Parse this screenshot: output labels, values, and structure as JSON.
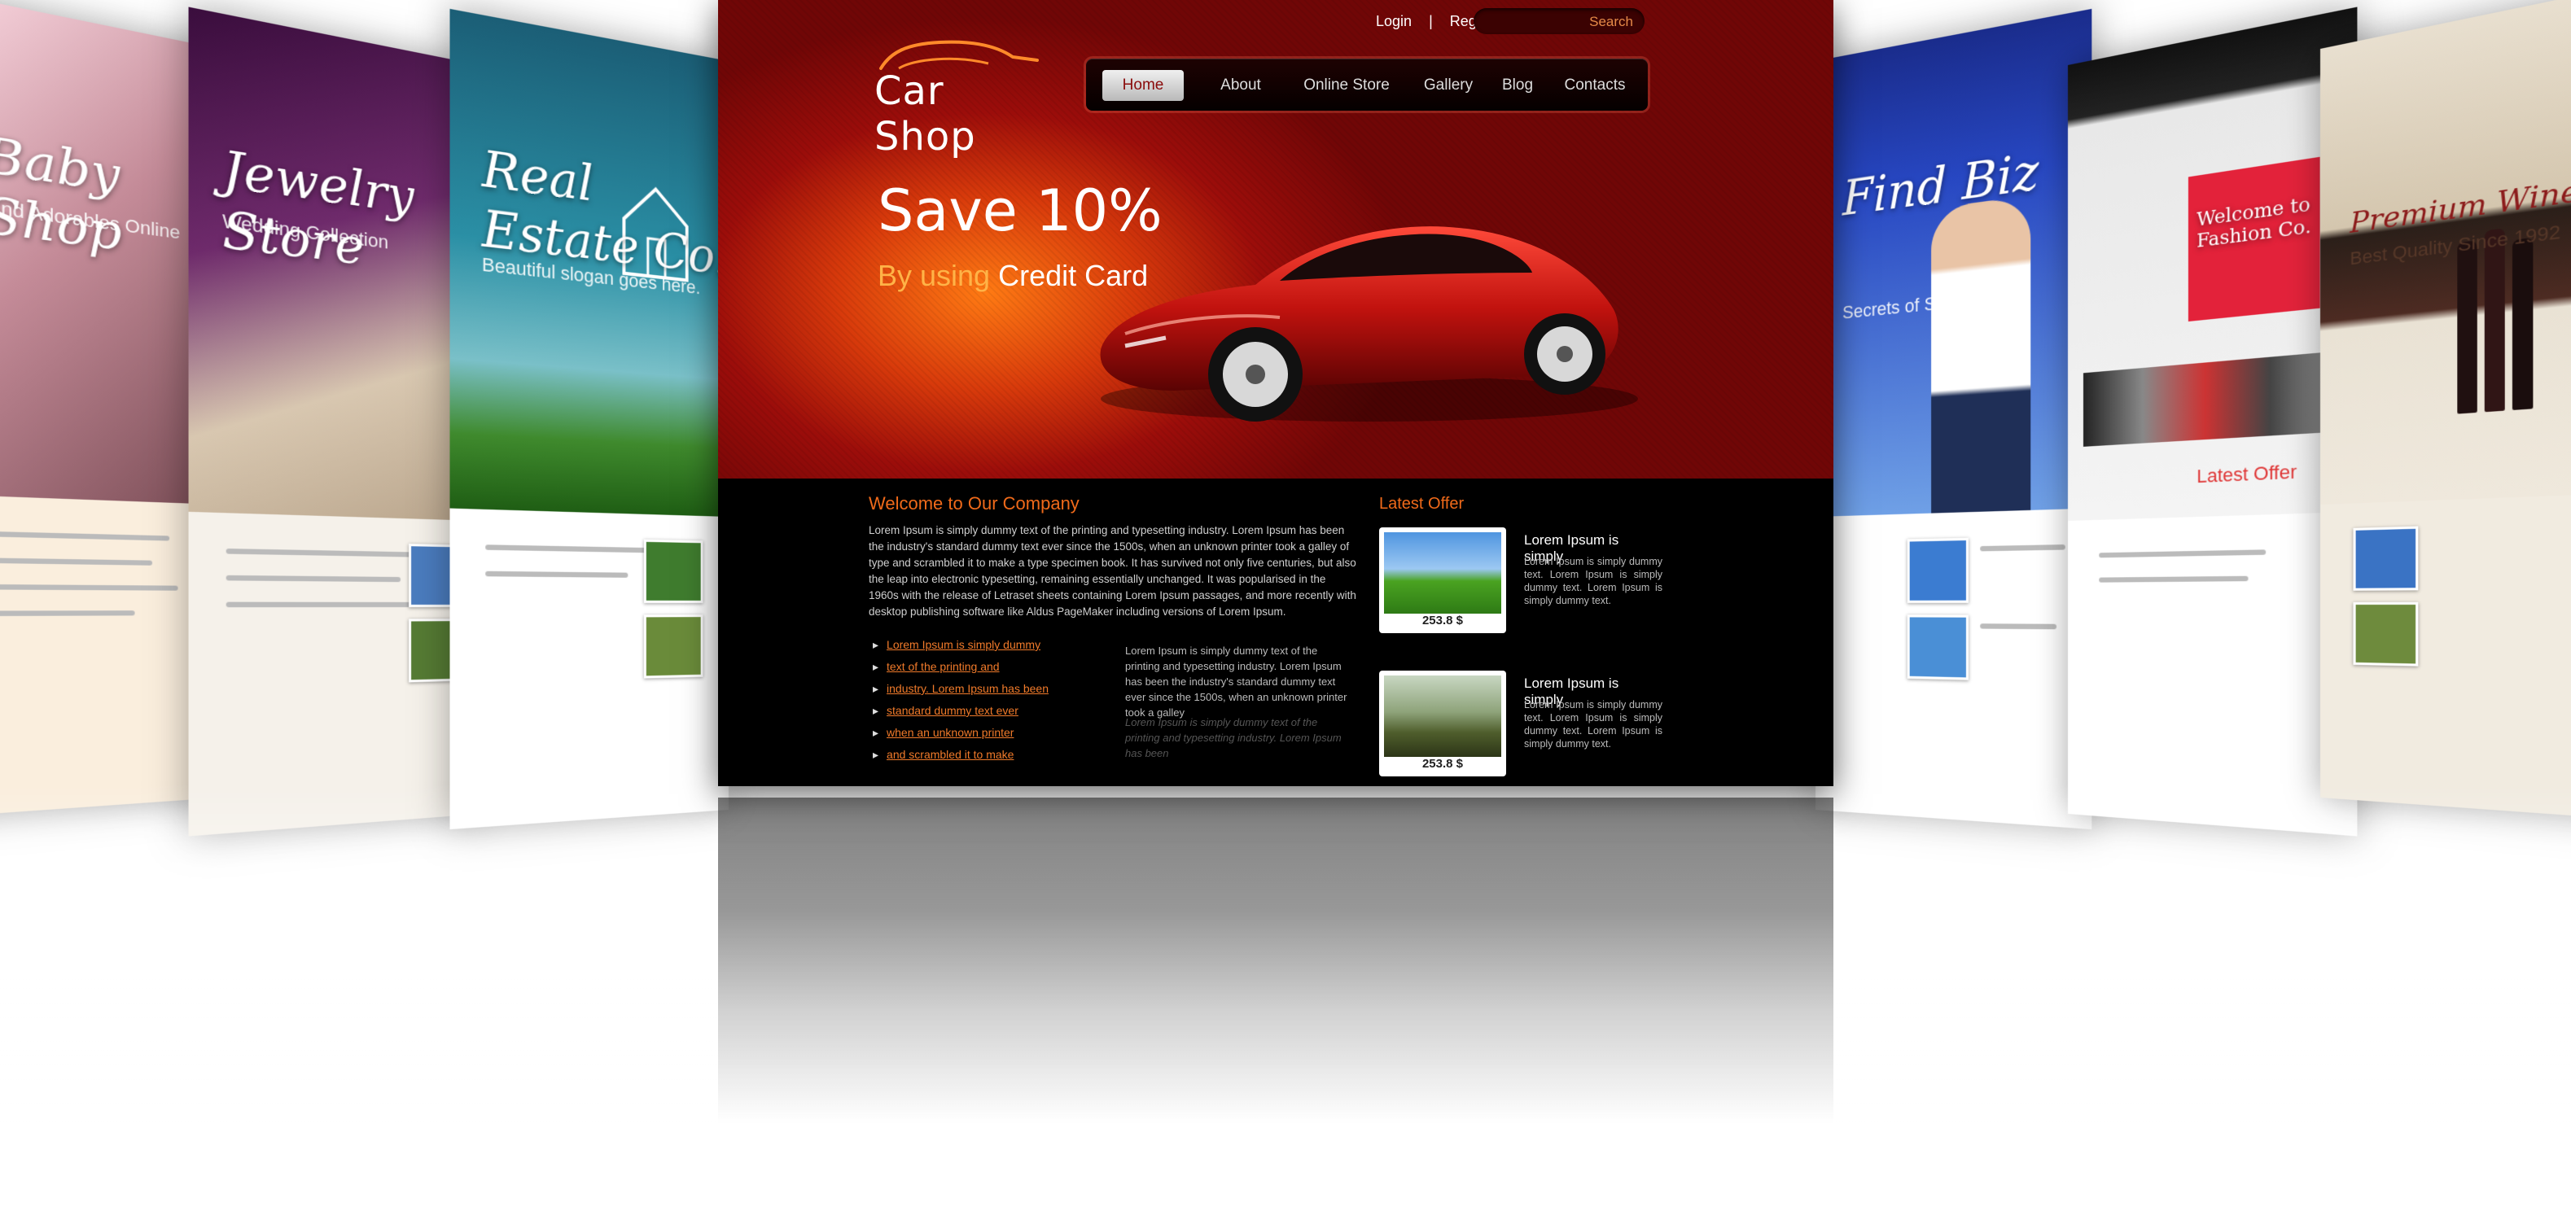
{
  "site": {
    "logo_text": "Car Shop",
    "top_links": {
      "login": "Login",
      "separator": "|",
      "register": "Register"
    },
    "search": {
      "button_label": "Search"
    },
    "nav": [
      {
        "label": "Home",
        "active": true
      },
      {
        "label": "About",
        "active": false
      },
      {
        "label": "Online Store",
        "active": false
      },
      {
        "label": "Gallery",
        "active": false
      },
      {
        "label": "Blog",
        "active": false
      },
      {
        "label": "Contacts",
        "active": false
      }
    ],
    "promo": {
      "title": "Save 10%",
      "subtitle_prefix": "By using",
      "subtitle_highlight": "Credit Card"
    },
    "welcome": {
      "title": "Welcome to Our Company",
      "text": "Lorem Ipsum is simply dummy text of the printing and typesetting industry. Lorem Ipsum has been the industry's standard dummy text ever since the 1500s, when an unknown printer took a galley of type and scrambled it to make a type specimen book. It has survived not only five centuries, but also the leap into electronic typesetting, remaining essentially unchanged. It was popularised in the 1960s with the release of Letraset sheets containing Lorem Ipsum passages, and more recently with desktop publishing software like Aldus PageMaker including versions of Lorem Ipsum.",
      "bullets": [
        "Lorem Ipsum is simply dummy",
        "text of the printing and",
        "industry. Lorem Ipsum has been",
        "standard dummy text ever",
        "when an unknown printer",
        "and scrambled it to make"
      ],
      "mid_text": "Lorem Ipsum is simply dummy text of the printing and typesetting industry. Lorem Ipsum has been the industry's standard dummy text ever since the 1500s, when an unknown printer took a galley",
      "mid_text_faded": "Lorem Ipsum is simply dummy text of the printing and typesetting industry. Lorem Ipsum has been"
    },
    "latest_offer": {
      "title": "Latest Offer",
      "items": [
        {
          "price": "253.8 $",
          "title": "Lorem Ipsum is simply",
          "text": "Lorem Ipsum is simply dummy text. Lorem Ipsum is simply dummy text. Lorem Ipsum is simply dummy text."
        },
        {
          "price": "253.8 $",
          "title": "Lorem Ipsum is simply",
          "text": "Lorem Ipsum is simply dummy text. Lorem Ipsum is simply dummy text. Lorem Ipsum is simply dummy text."
        }
      ]
    }
  },
  "side_pages": {
    "baby": {
      "title": "Baby Shop",
      "subtitle": "Find Adorables Online"
    },
    "jewelry": {
      "title": "Jewelry Store",
      "subtitle": "Wedding Collection"
    },
    "real_estate": {
      "title": "Real Estate Co.",
      "subtitle": "Beautiful slogan goes here."
    },
    "find_biz": {
      "title": "Find Biz",
      "subtitle": "Secrets of Success"
    },
    "fashion": {
      "title": "Welcome to Fashion Co.",
      "subtitle": "Latest Offer"
    },
    "wine": {
      "title": "Premium Wines",
      "subtitle": "Best Quality Since 1992"
    }
  },
  "colors": {
    "accent": "#f06a1a",
    "brand_red": "#9c0d0a",
    "background": "#ffffff"
  }
}
